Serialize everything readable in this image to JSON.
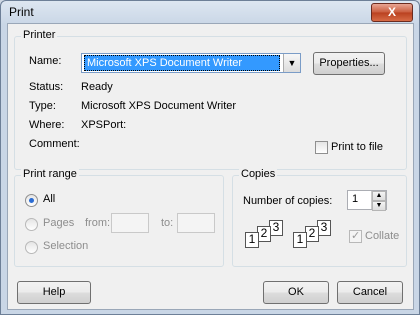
{
  "window": {
    "title": "Print",
    "close_label": "X"
  },
  "printer": {
    "legend": "Printer",
    "name_label": "Name:",
    "name_value": "Microsoft XPS Document Writer",
    "properties_label": "Properties...",
    "status_label": "Status:",
    "status_value": "Ready",
    "type_label": "Type:",
    "type_value": "Microsoft XPS Document Writer",
    "where_label": "Where:",
    "where_value": "XPSPort:",
    "comment_label": "Comment:",
    "print_to_file_label": "Print to file"
  },
  "range": {
    "legend": "Print range",
    "all_label": "All",
    "pages_label": "Pages",
    "from_label": "from:",
    "to_label": "to:",
    "selection_label": "Selection"
  },
  "copies": {
    "legend": "Copies",
    "number_label": "Number of copies:",
    "number_value": "1",
    "collate_label": "Collate",
    "page_numbers": [
      "1",
      "2",
      "3"
    ]
  },
  "buttons": {
    "help": "Help",
    "ok": "OK",
    "cancel": "Cancel"
  }
}
